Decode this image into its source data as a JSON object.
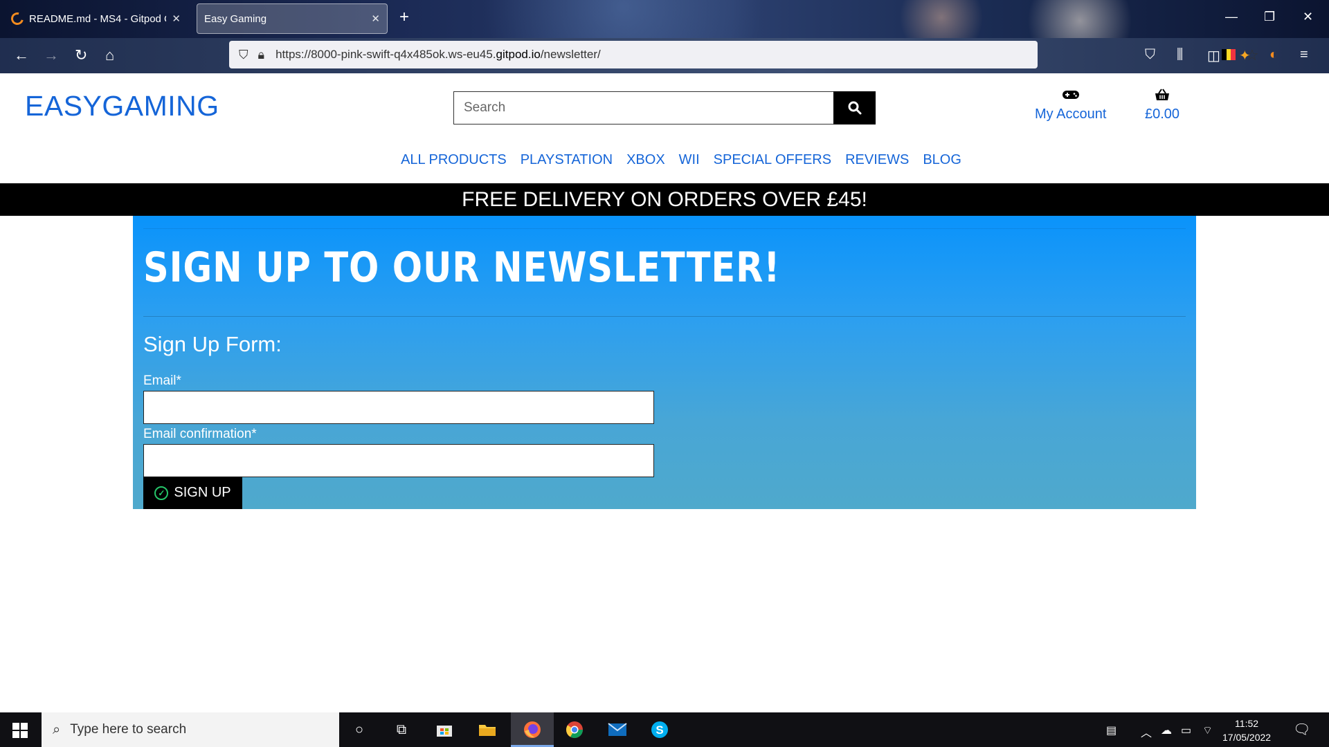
{
  "browser": {
    "tabs": [
      {
        "title": "README.md - MS4 - Gitpod Co",
        "active": false
      },
      {
        "title": "Easy Gaming",
        "active": true
      }
    ],
    "url_prefix": "https://8000-pink-swift-q4x485ok.ws-eu45.",
    "url_host": "gitpod.io",
    "url_path": "/newsletter/"
  },
  "site": {
    "logo_part1": "EASY",
    "logo_part2": "GAMING",
    "search_placeholder": "Search",
    "account_label": "My Account",
    "basket_total": "£0.00",
    "nav": [
      "ALL PRODUCTS",
      "PLAYSTATION",
      "XBOX",
      "WII",
      "SPECIAL OFFERS",
      "REVIEWS",
      "BLOG"
    ],
    "promo": "FREE DELIVERY ON ORDERS OVER £45!"
  },
  "newsletter": {
    "title": "SIGN UP TO OUR NEWSLETTER!",
    "form_title": "Sign Up Form:",
    "email_label": "Email*",
    "email_confirm_label": "Email confirmation*",
    "email_value": "",
    "email_confirm_value": "",
    "submit_label": "SIGN UP"
  },
  "taskbar": {
    "search_placeholder": "Type here to search",
    "time": "11:52",
    "date": "17/05/2022"
  },
  "colors": {
    "brand_blue": "#1565d8",
    "panel_top": "#0a93fb",
    "panel_bottom": "#4fa9cc",
    "check_green": "#26c66a"
  }
}
